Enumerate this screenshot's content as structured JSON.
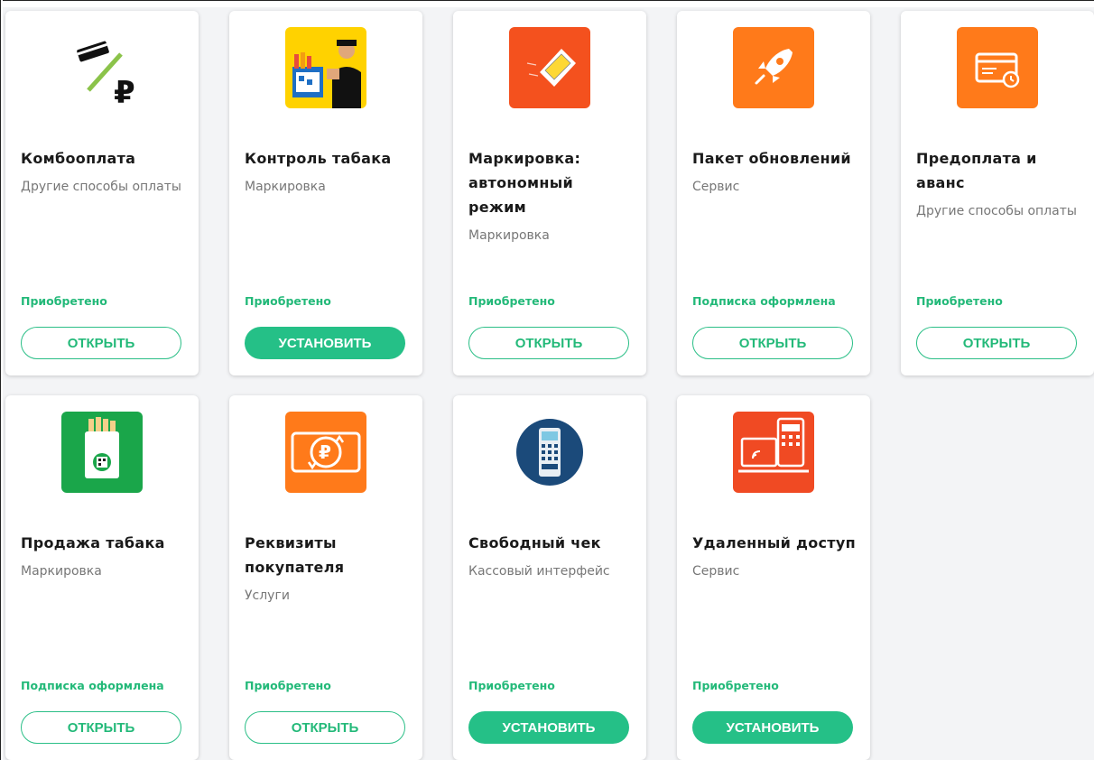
{
  "cards": [
    {
      "title": "Комбооплата",
      "subtitle": "Другие способы оплаты",
      "status": "Приобретено",
      "button": "ОТКРЫТЬ",
      "icon": "card-ruble-icon"
    },
    {
      "title": "Контроль табака",
      "subtitle": "Маркировка",
      "status": "Приобретено",
      "button": "УСТАНОВИТЬ",
      "icon": "tobacco-control-icon"
    },
    {
      "title": "Маркировка: автономный режим",
      "subtitle": "Маркировка",
      "status": "Приобретено",
      "button": "ОТКРЫТЬ",
      "icon": "marking-label-icon"
    },
    {
      "title": "Пакет обновлений",
      "subtitle": "Сервис",
      "status": "Подписка оформлена",
      "button": "ОТКРЫТЬ",
      "icon": "rocket-icon"
    },
    {
      "title": "Предоплата и аванс",
      "subtitle": "Другие способы оплаты",
      "status": "Приобретено",
      "button": "ОТКРЫТЬ",
      "icon": "card-clock-icon"
    },
    {
      "title": "Продажа табака",
      "subtitle": "Маркировка",
      "status": "Подписка оформлена",
      "button": "ОТКРЫТЬ",
      "icon": "cigarette-pack-icon"
    },
    {
      "title": "Реквизиты покупателя",
      "subtitle": "Услуги",
      "status": "Приобретено",
      "button": "ОТКРЫТЬ",
      "icon": "ruble-exchange-icon"
    },
    {
      "title": "Свободный чек",
      "subtitle": "Кассовый интерфейс",
      "status": "Приобретено",
      "button": "УСТАНОВИТЬ",
      "icon": "cash-terminal-icon"
    },
    {
      "title": "Удаленный доступ",
      "subtitle": "Сервис",
      "status": "Приобретено",
      "button": "УСТАНОВИТЬ",
      "icon": "remote-access-icon"
    }
  ],
  "colors": {
    "accent": "#23b979",
    "card_bg": "#ffffff",
    "page_bg": "#f3f4f6"
  }
}
